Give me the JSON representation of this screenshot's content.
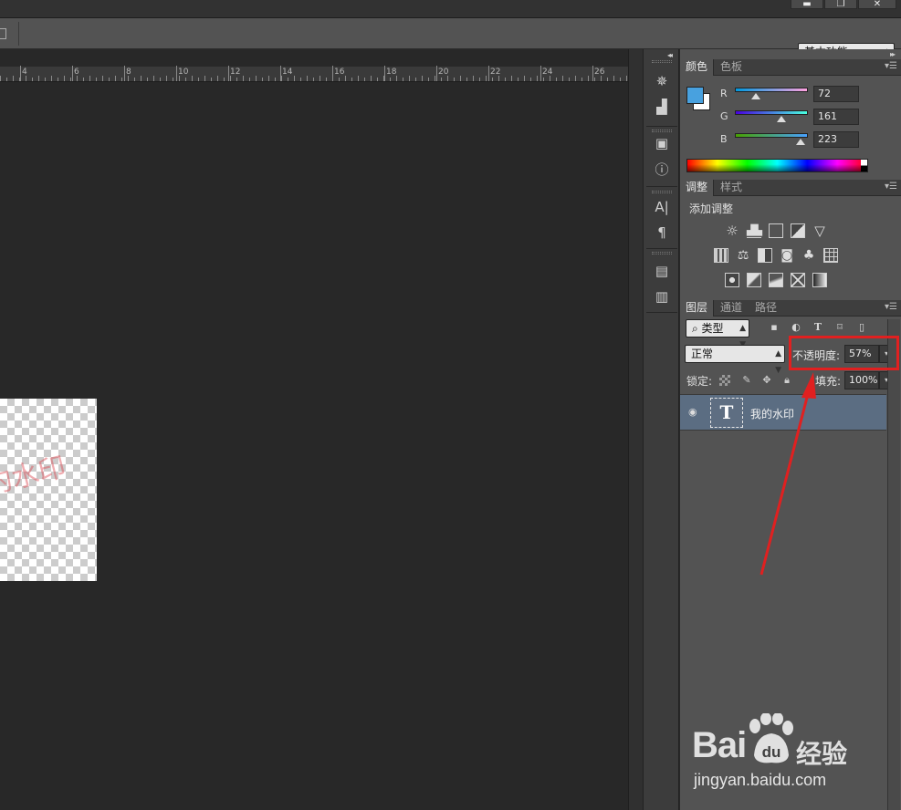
{
  "window": {
    "minimize_glyph": "▬",
    "restore_glyph": "❐",
    "close_glyph": "✕"
  },
  "options_bar": {
    "workspace": "基本功能"
  },
  "ruler": {
    "labels": [
      "4",
      "6",
      "8",
      "10",
      "12",
      "14",
      "16",
      "18",
      "20",
      "22",
      "24",
      "26"
    ]
  },
  "canvas": {
    "watermark_text": "的水印"
  },
  "icon_strip": {
    "collapse_glyph": "◂◂"
  },
  "color_panel": {
    "tabs": [
      "颜色",
      "色板"
    ],
    "foreground_color": "#48a1df",
    "channels": [
      {
        "label": "R",
        "value": "72"
      },
      {
        "label": "G",
        "value": "161"
      },
      {
        "label": "B",
        "value": "223"
      }
    ]
  },
  "adjustments_panel": {
    "tabs": [
      "调整",
      "样式"
    ],
    "title": "添加调整"
  },
  "layers_panel": {
    "tabs": [
      "图层",
      "通道",
      "路径"
    ],
    "filter_kind": "类型",
    "blend_mode": "正常",
    "opacity_label": "不透明度:",
    "opacity_value": "57%",
    "lock_label": "锁定:",
    "fill_label": "填充:",
    "fill_value": "100%",
    "layer": {
      "name": "我的水印",
      "type_glyph": "T"
    }
  },
  "colors": {
    "annotation": "#e02020",
    "layer_selected": "#5b6d82"
  },
  "baidu_watermark": {
    "logo": "Bai",
    "logo_tail": "du",
    "cn": "经验",
    "url": "jingyan.baidu.com"
  }
}
